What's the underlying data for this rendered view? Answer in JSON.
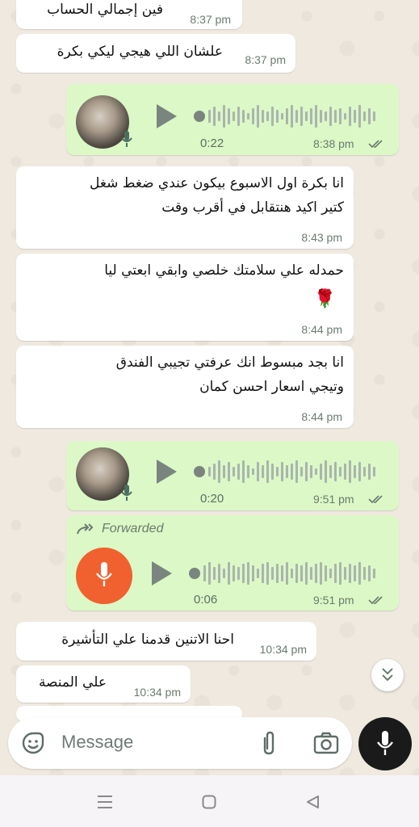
{
  "messages": [
    {
      "id": "m1",
      "type": "text",
      "direction": "in",
      "text": "فين إجمالي الحساب",
      "time": "8:37 pm"
    },
    {
      "id": "m2",
      "type": "text",
      "direction": "in",
      "text": "علشان اللي هيجي ليكي بكرة",
      "time": "8:37 pm"
    },
    {
      "id": "m3",
      "type": "voice",
      "direction": "out",
      "duration": "0:22",
      "time": "8:38 pm"
    },
    {
      "id": "m4",
      "type": "text",
      "direction": "in",
      "lines": [
        "انا بكرة اول الاسبوع بيكون عندي ضغط شغل",
        "كتير اكيد هنتقابل في أقرب وقت"
      ],
      "time": "8:43 pm"
    },
    {
      "id": "m5",
      "type": "text",
      "direction": "in",
      "lines": [
        "حمدله علي سلامتك خلصي وابقي ابعتي ليا",
        "🌹"
      ],
      "time": "8:44 pm"
    },
    {
      "id": "m6",
      "type": "text",
      "direction": "in",
      "lines": [
        "انا بجد مبسوط انك عرفتي تجيبي الفندق",
        "وتيجي اسعار احسن كمان"
      ],
      "time": "8:44 pm"
    },
    {
      "id": "m7",
      "type": "voice",
      "direction": "out",
      "duration": "0:20",
      "time": "9:51 pm"
    },
    {
      "id": "m8",
      "type": "voice",
      "direction": "out",
      "forwarded": "Forwarded",
      "duration": "0:06",
      "time": "9:51 pm"
    },
    {
      "id": "m9",
      "type": "text",
      "direction": "in",
      "text": "احنا الاتنين قدمنا علي التأشيرة",
      "time": "10:34 pm"
    },
    {
      "id": "m10",
      "type": "text",
      "direction": "in",
      "text": "علي المنصة",
      "time": "10:34 pm"
    }
  ],
  "composer": {
    "placeholder": "Message",
    "emoji_icon": "emoji-icon",
    "attach_icon": "paperclip-icon",
    "camera_icon": "camera-icon",
    "mic_icon": "microphone-icon"
  },
  "colors": {
    "incoming": "#ffffff",
    "outgoing": "#dcf8c6",
    "read_ticks": "#6b7a6f",
    "forwarded_mic": "#f0612f"
  },
  "navigation": {
    "icons": [
      "menu-icon",
      "home-icon",
      "back-icon"
    ]
  }
}
